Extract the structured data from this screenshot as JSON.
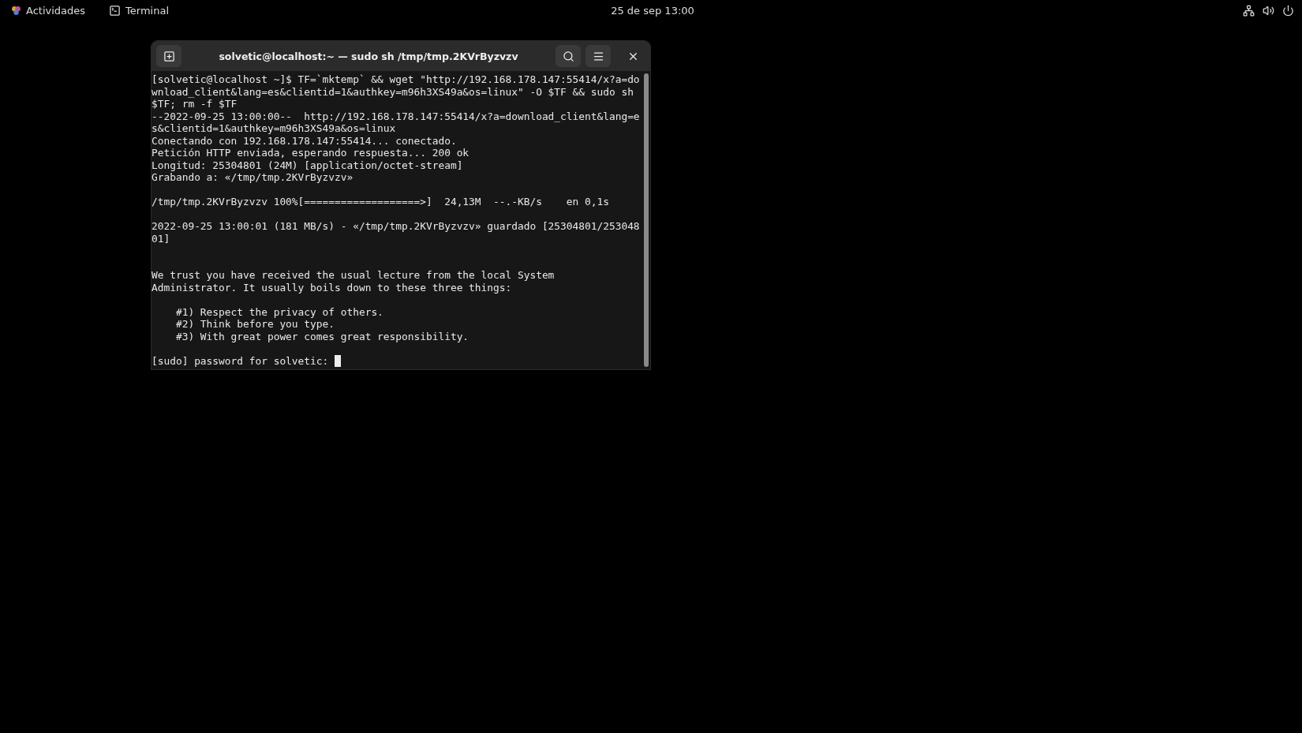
{
  "top_bar": {
    "activities": "Actividades",
    "app": "Terminal",
    "clock": "25 de sep  13:00"
  },
  "window": {
    "title": "solvetic@localhost:~ — sudo sh /tmp/tmp.2KVrByzvzv",
    "lines": [
      {
        "kind": "text",
        "text": "[solvetic@localhost ~]$ TF=`mktemp` && wget \"http://192.168.178.147:55414/x?a=download_client&lang=es&clientid=1&authkey=m96h3XS49a&os=linux\" -O $TF && sudo sh $TF; rm -f $TF"
      },
      {
        "kind": "text",
        "text": "--2022-09-25 13:00:00--  http://192.168.178.147:55414/x?a=download_client&lang=es&clientid=1&authkey=m96h3XS49a&os=linux"
      },
      {
        "kind": "text",
        "text": "Conectando con 192.168.178.147:55414... conectado."
      },
      {
        "kind": "text",
        "text": "Petición HTTP enviada, esperando respuesta... 200 ok"
      },
      {
        "kind": "text",
        "text": "Longitud: 25304801 (24M) [application/octet-stream]"
      },
      {
        "kind": "text",
        "text": "Grabando a: «/tmp/tmp.2KVrByzvzv»"
      },
      {
        "kind": "blank"
      },
      {
        "kind": "text",
        "text": "/tmp/tmp.2KVrByzvzv 100%[===================>]  24,13M  --.-KB/s    en 0,1s"
      },
      {
        "kind": "blank"
      },
      {
        "kind": "text",
        "text": "2022-09-25 13:00:01 (181 MB/s) - «/tmp/tmp.2KVrByzvzv» guardado [25304801/25304801]"
      },
      {
        "kind": "blank"
      },
      {
        "kind": "blank"
      },
      {
        "kind": "text",
        "text": "We trust you have received the usual lecture from the local System"
      },
      {
        "kind": "text",
        "text": "Administrator. It usually boils down to these three things:"
      },
      {
        "kind": "blank"
      },
      {
        "kind": "text",
        "text": "    #1) Respect the privacy of others."
      },
      {
        "kind": "text",
        "text": "    #2) Think before you type."
      },
      {
        "kind": "text",
        "text": "    #3) With great power comes great responsibility."
      },
      {
        "kind": "blank"
      },
      {
        "kind": "prompt",
        "text": "[sudo] password for solvetic: "
      }
    ]
  }
}
